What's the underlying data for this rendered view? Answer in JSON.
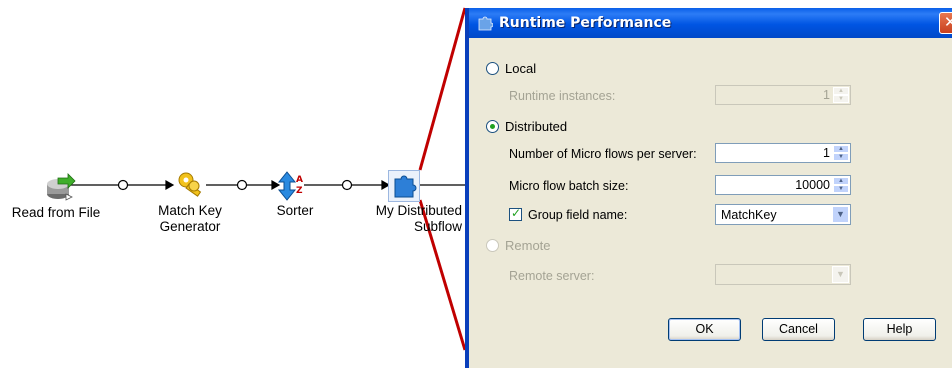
{
  "flow": {
    "nodes": [
      {
        "label": "Read from File",
        "icon": "read-file-icon"
      },
      {
        "label": "Match Key\nGenerator",
        "icon": "key-icon"
      },
      {
        "label": "Sorter",
        "icon": "sort-icon"
      },
      {
        "label": "My Distributed\nSubflow",
        "icon": "puzzle-icon"
      }
    ]
  },
  "dialog": {
    "title": "Runtime Performance",
    "local_label": "Local",
    "runtime_instances_label": "Runtime instances:",
    "runtime_instances_value": "1",
    "distributed_label": "Distributed",
    "micro_flows_label": "Number of Micro flows per server:",
    "micro_flows_value": "1",
    "batch_size_label": "Micro flow batch size:",
    "batch_size_value": "10000",
    "group_field_label": "Group field name:",
    "group_field_value": "MatchKey",
    "remote_label": "Remote",
    "remote_server_label": "Remote server:",
    "remote_server_value": "",
    "ok_label": "OK",
    "cancel_label": "Cancel",
    "help_label": "Help",
    "selected_mode": "Distributed",
    "group_field_checked": true
  },
  "colors": {
    "title_bar": "#0055e3",
    "dialog_bg": "#ece9d8",
    "callout_line": "#c00000"
  }
}
